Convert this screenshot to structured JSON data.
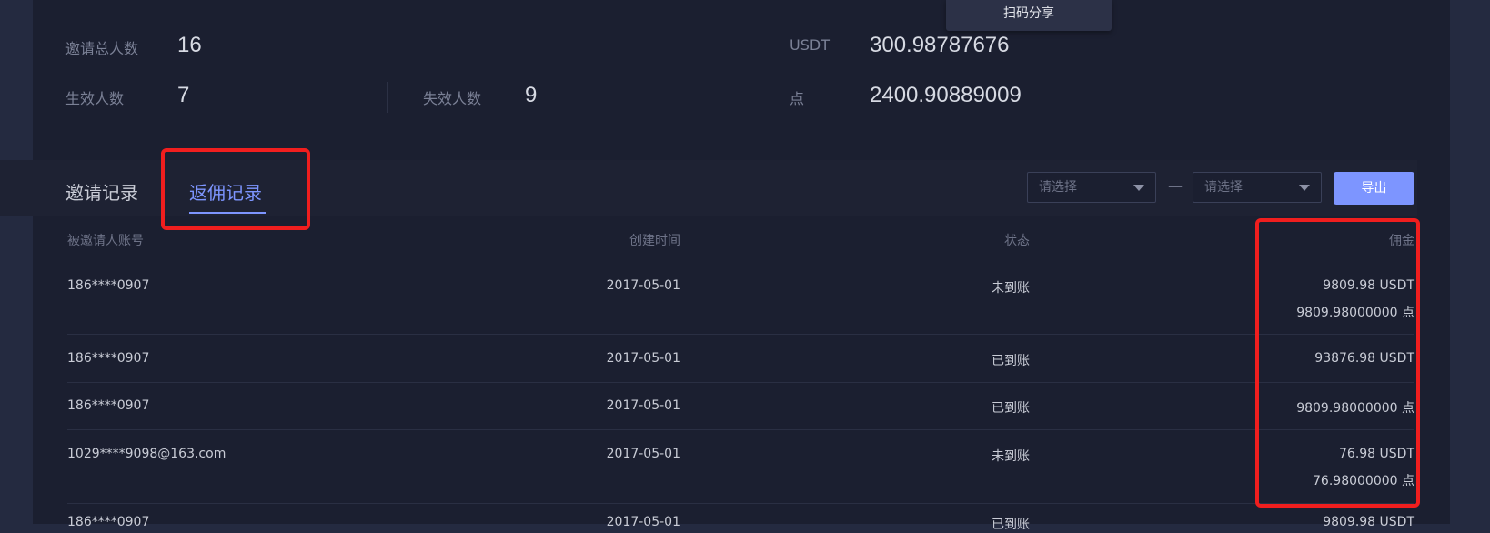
{
  "popup": {
    "share_label": "扫码分享"
  },
  "stats": {
    "total_invites_label": "邀请总人数",
    "total_invites_value": "16",
    "effective_label": "生效人数",
    "effective_value": "7",
    "invalid_label": "失效人数",
    "invalid_value": "9",
    "usdt_label": "USDT",
    "usdt_value": "300.98787676",
    "points_label": "点",
    "points_value": "2400.90889009"
  },
  "tabs": [
    {
      "label": "邀请记录",
      "active": false
    },
    {
      "label": "返佣记录",
      "active": true
    }
  ],
  "filters": {
    "start_placeholder": "请选择",
    "end_placeholder": "请选择",
    "separator": "—",
    "export_label": "导出"
  },
  "table": {
    "headers": [
      "被邀请人账号",
      "创建时间",
      "状态",
      "佣金"
    ],
    "rows": [
      {
        "account": "186****0907",
        "date": "2017-05-01",
        "status": "未到账",
        "commission_line1": "9809.98 USDT",
        "commission_line2": "9809.98000000 点"
      },
      {
        "account": "186****0907",
        "date": "2017-05-01",
        "status": "已到账",
        "commission_line1": "93876.98 USDT",
        "commission_line2": ""
      },
      {
        "account": "186****0907",
        "date": "2017-05-01",
        "status": "已到账",
        "commission_line1": "9809.98000000 点",
        "commission_line2": ""
      },
      {
        "account": "1029****9098@163.com",
        "date": "2017-05-01",
        "status": "未到账",
        "commission_line1": "76.98 USDT",
        "commission_line2": "76.98000000 点"
      },
      {
        "account": "186****0907",
        "date": "2017-05-01",
        "status": "已到账",
        "commission_line1": "9809.98 USDT",
        "commission_line2": ""
      }
    ]
  },
  "colors": {
    "accent": "#7d95ff",
    "highlight": "#f01e1e",
    "background": "#1b1f30"
  }
}
